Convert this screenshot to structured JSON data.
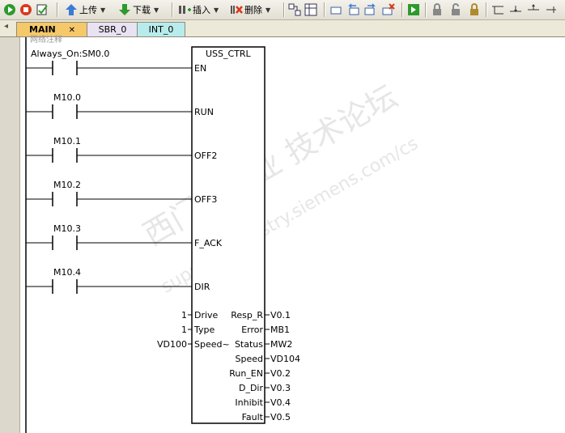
{
  "toolbar": {
    "upload_label": "上传",
    "download_label": "下载",
    "insert_label": "插入",
    "delete_label": "删除"
  },
  "tabs": {
    "arrow": "◂",
    "main": "MAIN",
    "main_close": "✕",
    "sbr": "SBR_0",
    "int": "INT_0"
  },
  "ladder": {
    "comment_fragment": "网络注释",
    "contacts": [
      "Always_On:SM0.0",
      "M10.0",
      "M10.1",
      "M10.2",
      "M10.3",
      "M10.4"
    ],
    "block": {
      "title": "USS_CTRL",
      "inputs": [
        "EN",
        "RUN",
        "OFF2",
        "OFF3",
        "F_ACK",
        "DIR"
      ],
      "param_inputs": [
        "Drive",
        "Type",
        "Speed~"
      ],
      "param_values": [
        "1",
        "1",
        "VD100"
      ],
      "outputs": [
        "Resp_R",
        "Error",
        "Status",
        "Speed",
        "Run_EN",
        "D_Dir",
        "Inhibit",
        "Fault"
      ],
      "output_values": [
        "V0.1",
        "MB1",
        "MW2",
        "VD104",
        "V0.2",
        "V0.3",
        "V0.4",
        "V0.5"
      ]
    }
  },
  "watermark": {
    "cn": "西门子工业 技术论坛",
    "url": "support.industry.siemens.com/cs"
  }
}
